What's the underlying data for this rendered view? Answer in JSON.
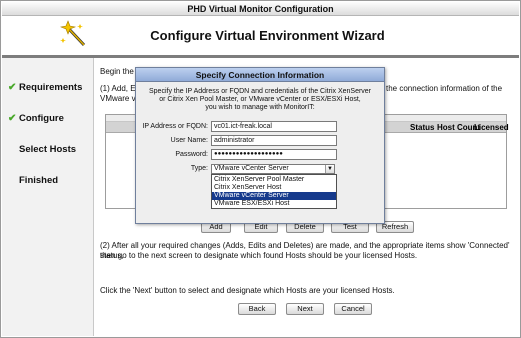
{
  "window": {
    "title": "PHD Virtual Monitor Configuration"
  },
  "header": {
    "title": "Configure Virtual Environment Wizard",
    "icon": "wizard-wand-icon"
  },
  "sidebar": {
    "steps": [
      {
        "label": "Requirements",
        "done": true
      },
      {
        "label": "Configure",
        "done": true
      },
      {
        "label": "Select Hosts",
        "done": false
      },
      {
        "label": "Finished",
        "done": false
      }
    ]
  },
  "main": {
    "intro_visible": "Begin the",
    "step1_left": "(1) Add, E",
    "step1_left2": "VMware vC",
    "step1_right": "the connection information of the",
    "grid": {
      "columns": [
        "ion",
        "Status",
        "Host Count",
        "Licensed"
      ]
    },
    "buttons": {
      "add": "Add",
      "edit": "Edit",
      "delete": "Delete",
      "test": "Test",
      "refresh": "Refresh"
    },
    "step2_line1": "(2) After all your required changes (Adds, Edits and Deletes) are made, and the appropriate items show 'Connected' status,",
    "step2_line2": "then go to the next screen to designate which found Hosts should be your licensed Hosts.",
    "next_note": "Click the 'Next' button to select and designate which Hosts are your licensed Hosts.",
    "nav": {
      "back": "Back",
      "next": "Next",
      "cancel": "Cancel"
    }
  },
  "dialog": {
    "title": "Specify Connection Information",
    "description_lines": [
      "Specify the IP Address or FQDN and credentials of the Citrix XenServer",
      "or Citrix Xen Pool Master, or VMware vCenter or ESX/ESXi Host,",
      "you wish to manage with MonitorIT:"
    ],
    "fields": {
      "ip_label": "IP Address or FQDN:",
      "ip_value": "vc01.ict-freak.local",
      "user_label": "User Name:",
      "user_value": "administrator",
      "password_label": "Password:",
      "password_value": "●●●●●●●●●●●●●●●●●●●",
      "type_label": "Type:",
      "type_value": "VMware vCenter Server"
    },
    "type_options": [
      "Citrix XenServer Pool Master",
      "Citrix XenServer Host",
      "VMware vCenter Server",
      "VMware ESX/ESXi Host"
    ],
    "selected_option_index": 2
  },
  "colors": {
    "check": "#49a82b",
    "dialog_title": "#90abd8",
    "selected_option": "#163a8c"
  }
}
